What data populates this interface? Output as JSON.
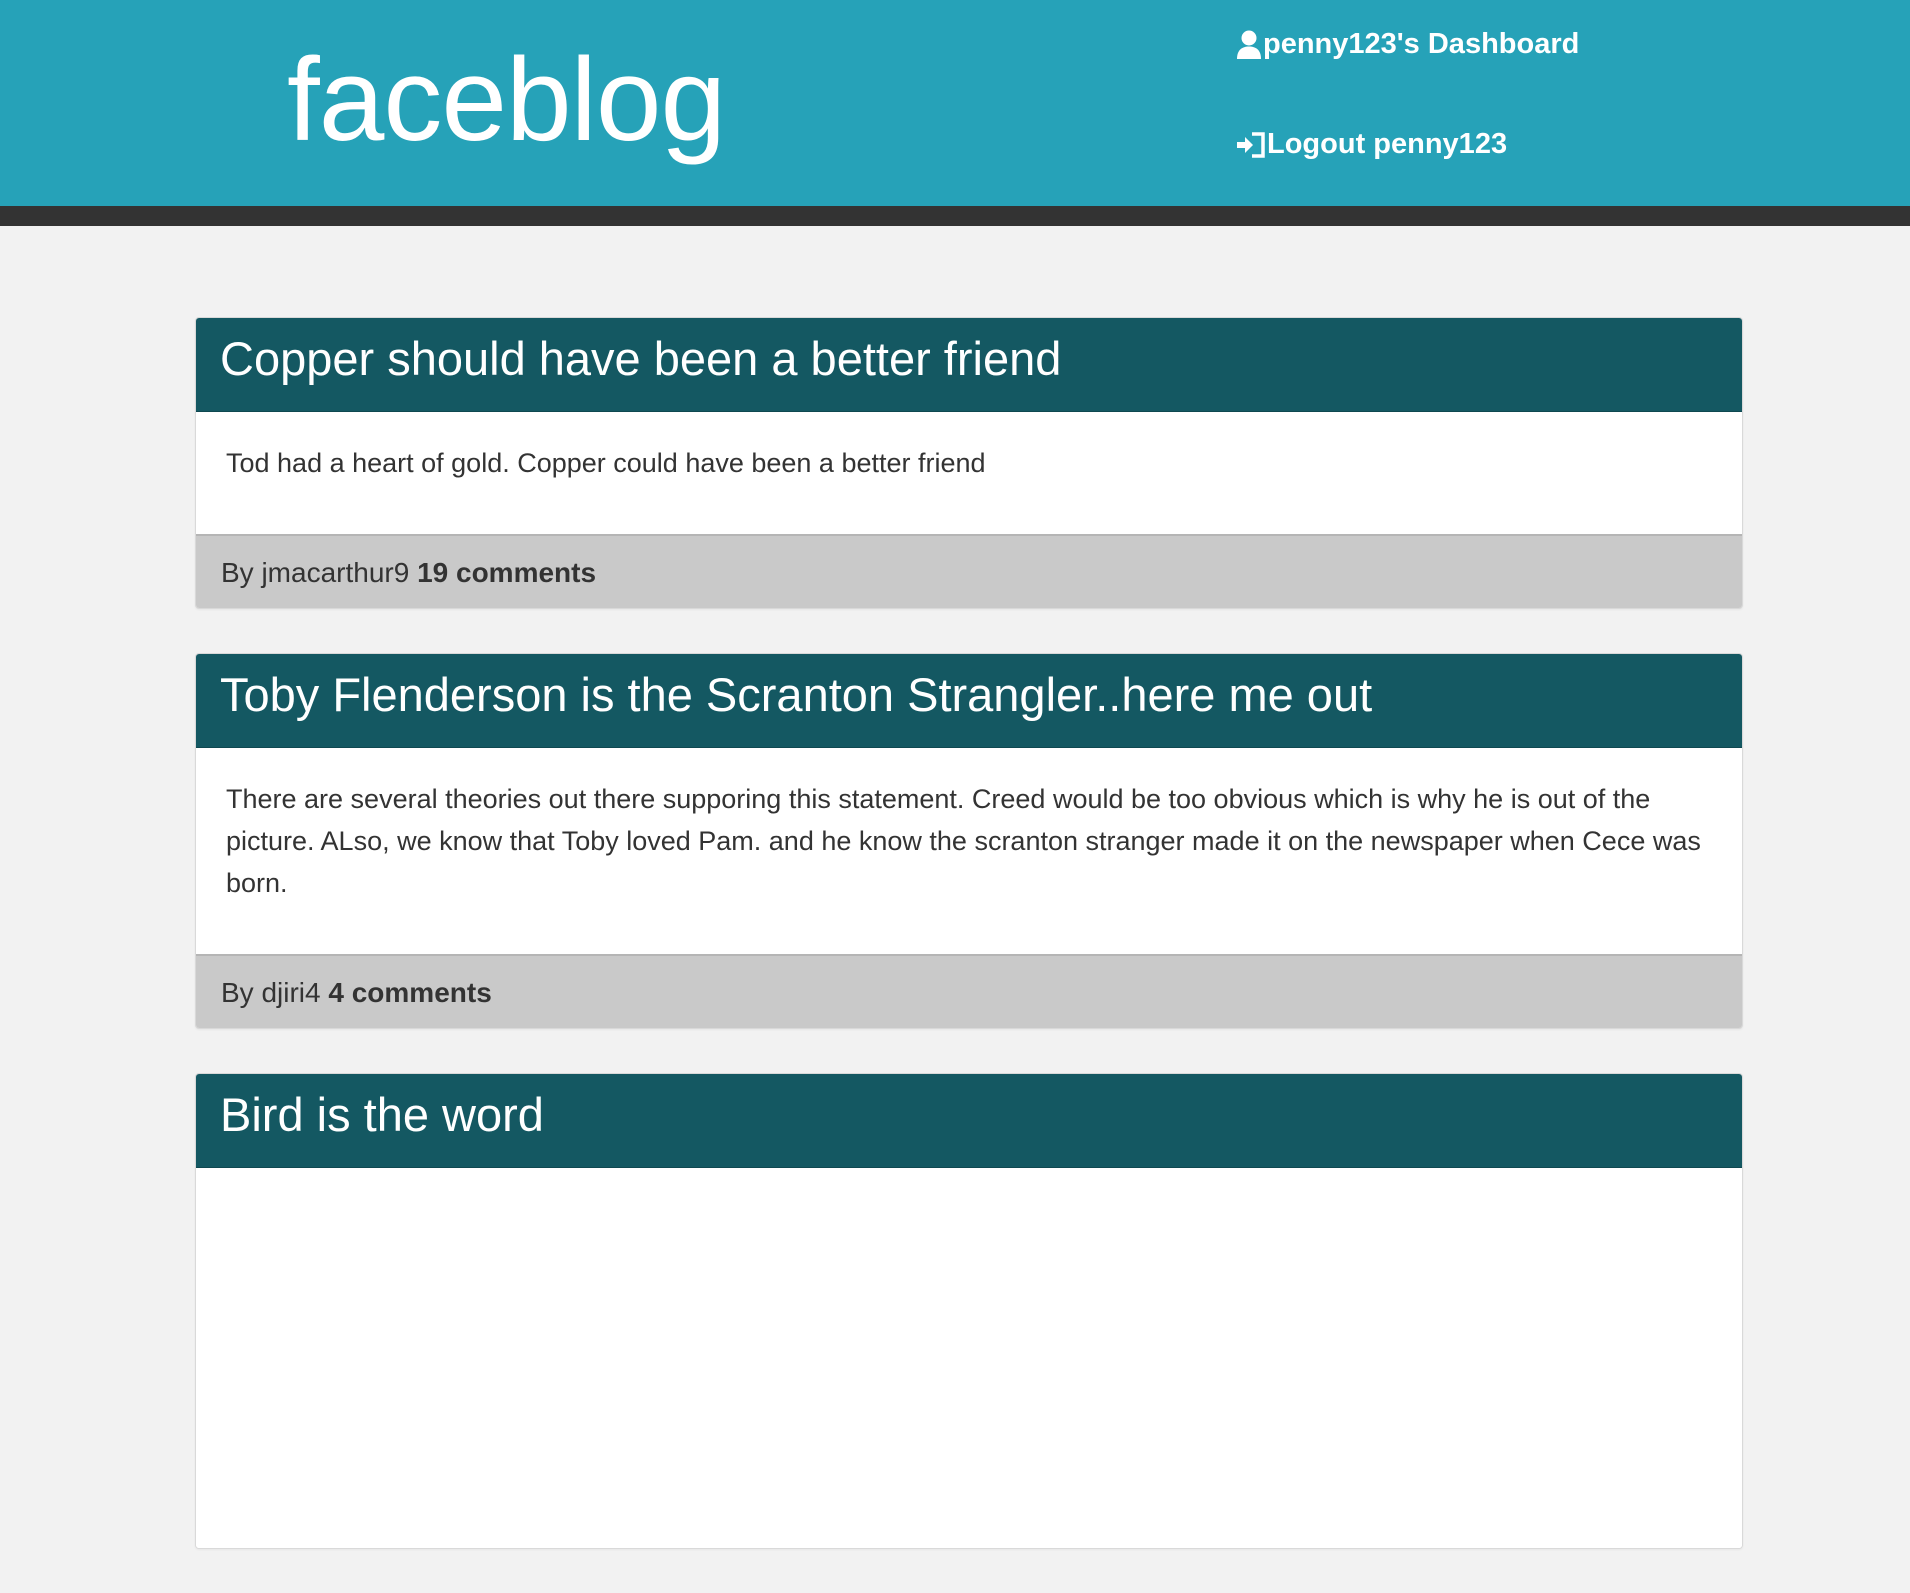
{
  "header": {
    "logo": "faceblog",
    "dashboard_label": "penny123's Dashboard",
    "logout_label": "Logout penny123"
  },
  "posts": [
    {
      "title": "Copper should have been a better friend",
      "body": "Tod had a heart of gold. Copper could have been a better friend",
      "by": "By jmacarthur9",
      "comments": "19 comments"
    },
    {
      "title": "Toby Flenderson is the Scranton Strangler..here me out",
      "body": "There are several theories out there supporing this statement. Creed would be too obvious which is why he is out of the picture. ALso, we know that Toby loved Pam. and he know the scranton stranger made it on the newspaper when Cece was born.",
      "by": "By djiri4",
      "comments": "4 comments"
    },
    {
      "title": "Bird is the word"
    }
  ],
  "icons": {
    "dashboard": "user-icon",
    "logout": "log-in-icon"
  },
  "colors": {
    "header_bg": "#26a2b8",
    "header_border": "#333333",
    "post_title_bg": "#145862",
    "post_footer_bg": "#c9c9c9",
    "page_bg": "#f2f2f2"
  }
}
